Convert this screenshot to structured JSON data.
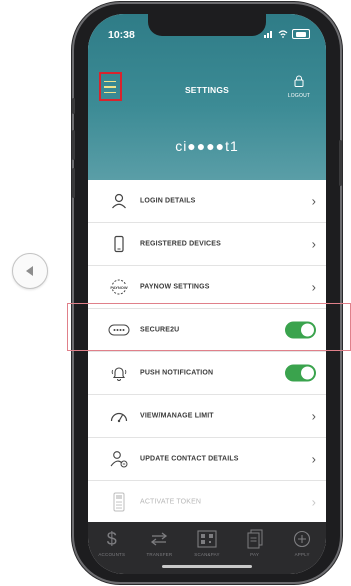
{
  "status_bar": {
    "time": "10:38"
  },
  "header": {
    "title": "SETTINGS",
    "logout_label": "LOGOUT",
    "username": "ci●●●●t1"
  },
  "menu": [
    {
      "label": "LOGIN DETAILS",
      "icon": "user-icon",
      "control": "chevron"
    },
    {
      "label": "REGISTERED DEVICES",
      "icon": "phone-icon",
      "control": "chevron"
    },
    {
      "label": "PAYNOW SETTINGS",
      "icon": "paynow-icon",
      "control": "chevron"
    },
    {
      "label": "SECURE2U",
      "icon": "password-icon",
      "control": "toggle",
      "enabled": true
    },
    {
      "label": "PUSH NOTIFICATION",
      "icon": "bell-icon",
      "control": "toggle",
      "enabled": true
    },
    {
      "label": "VIEW/MANAGE LIMIT",
      "icon": "gauge-icon",
      "control": "chevron"
    },
    {
      "label": "UPDATE CONTACT DETAILS",
      "icon": "contact-icon",
      "control": "chevron"
    },
    {
      "label": "ACTIVATE TOKEN",
      "icon": "token-icon",
      "control": "chevron",
      "disabled": true
    }
  ],
  "tabbar": [
    {
      "label": "ACCOUNTS",
      "icon": "dollar-icon"
    },
    {
      "label": "TRANSFER",
      "icon": "transfer-icon"
    },
    {
      "label": "SCAN&PAY",
      "icon": "qr-icon"
    },
    {
      "label": "PAY",
      "icon": "bill-icon"
    },
    {
      "label": "APPLY",
      "icon": "plus-circle-icon"
    }
  ],
  "colors": {
    "header_teal": "#3c8b95",
    "toggle_on": "#3aa34d",
    "highlight_red": "#d9232d",
    "tabbar_bg": "#2b2b2d"
  }
}
